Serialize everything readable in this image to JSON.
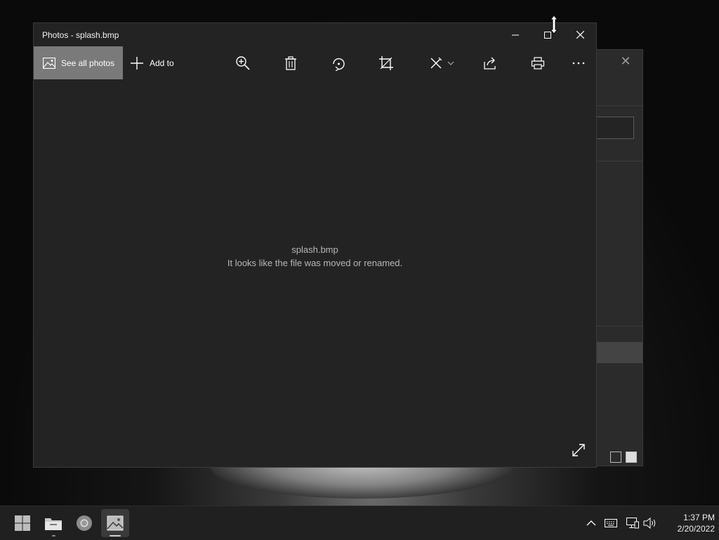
{
  "window": {
    "title": "Photos - splash.bmp"
  },
  "toolbar": {
    "see_all_photos": "See all photos",
    "add_to": "Add to",
    "tools": [
      "zoom-in-icon",
      "delete-icon",
      "rotate-icon",
      "crop-icon",
      "edit-icon",
      "share-icon",
      "print-icon",
      "more-icon"
    ]
  },
  "content": {
    "filename": "splash.bmp",
    "message": "It looks like the file was moved or renamed."
  },
  "taskbar": {
    "apps": [
      "start-icon",
      "file-explorer-icon",
      "chrome-icon",
      "photos-icon"
    ],
    "clock": {
      "time": "1:37 PM",
      "date": "2/20/2022"
    }
  },
  "colors": {
    "window_bg": "#232323",
    "selected_tab": "#7a7a7a",
    "taskbar_bg": "#202020"
  }
}
